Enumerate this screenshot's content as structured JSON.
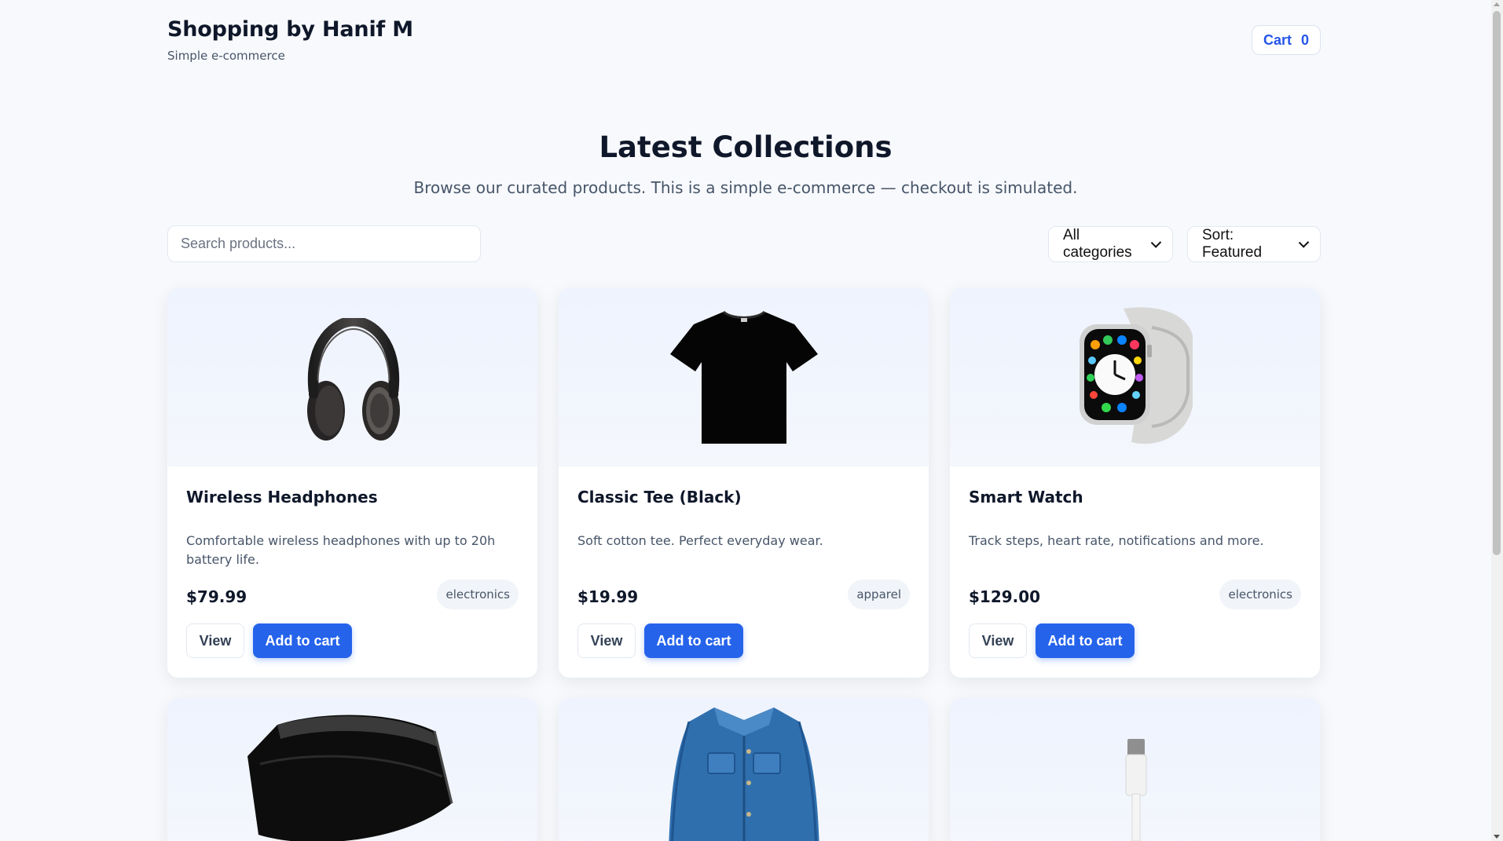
{
  "header": {
    "title": "Shopping by Hanif M",
    "subtitle": "Simple e-commerce",
    "cart_label": "Cart",
    "cart_count": "0"
  },
  "hero": {
    "title": "Latest Collections",
    "subtitle": "Browse our curated products. This is a simple e-commerce — checkout is simulated."
  },
  "filters": {
    "search_placeholder": "Search products...",
    "category_selected": "All categories",
    "sort_selected": "Sort: Featured"
  },
  "products": [
    {
      "name": "Wireless Headphones",
      "description": "Comfortable wireless headphones with up to 20h battery life.",
      "price": "$79.99",
      "category": "electronics",
      "image_icon": "headphones-icon"
    },
    {
      "name": "Classic Tee (Black)",
      "description": "Soft cotton tee. Perfect everyday wear.",
      "price": "$19.99",
      "category": "apparel",
      "image_icon": "tshirt-icon"
    },
    {
      "name": "Smart Watch",
      "description": "Track steps, heart rate, notifications and more.",
      "price": "$129.00",
      "category": "electronics",
      "image_icon": "smartwatch-icon"
    },
    {
      "image_icon": "wallet-icon"
    },
    {
      "image_icon": "denim-jacket-icon"
    },
    {
      "image_icon": "usb-c-cable-icon"
    }
  ],
  "card_actions": {
    "view_label": "View",
    "add_label": "Add to cart"
  },
  "colors": {
    "accent": "#2563eb",
    "background": "#f7f9fc",
    "text": "#0f172a",
    "muted": "#475569"
  }
}
